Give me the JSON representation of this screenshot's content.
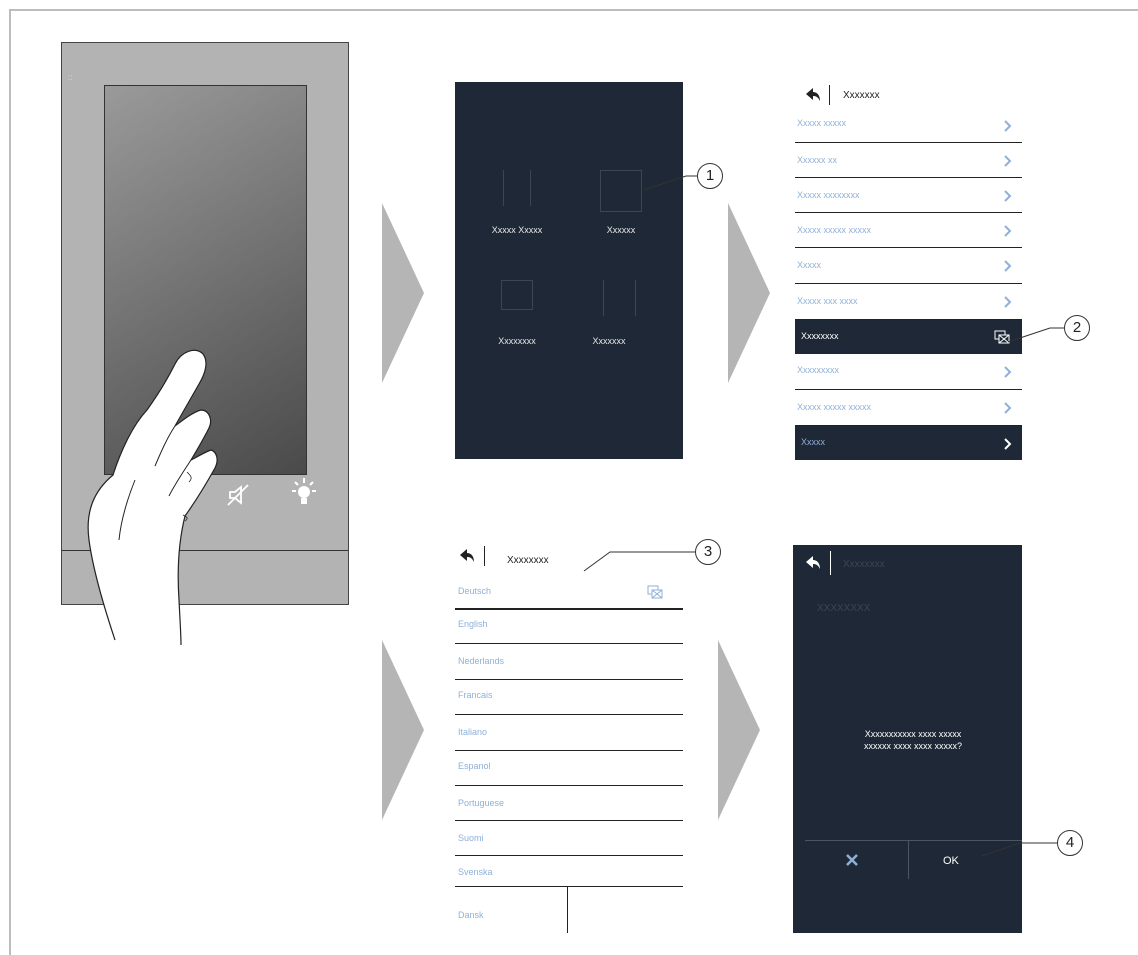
{
  "device": {
    "icons": [
      "mute-icon",
      "light-bulb-icon"
    ]
  },
  "panel1": {
    "items": [
      {
        "label": "Xxxxx Xxxxx"
      },
      {
        "label": "Xxxxxx"
      },
      {
        "label": "Xxxxxxxx"
      },
      {
        "label": "Xxxxxxx"
      }
    ]
  },
  "panel2": {
    "title": "Xxxxxxx",
    "rows": [
      {
        "label": "Xxxxx xxxxx"
      },
      {
        "label": "Xxxxxx xx"
      },
      {
        "label": "Xxxxx xxxxxxxx"
      },
      {
        "label": "Xxxxx xxxxx xxxxx"
      },
      {
        "label": "Xxxxx"
      },
      {
        "label": "Xxxxx xxx xxxx"
      },
      {
        "label": "Xxxxxxxx"
      },
      {
        "label": "Xxxxxxxxx"
      },
      {
        "label": "Xxxxx xxxxx xxxxx"
      },
      {
        "label": "Xxxxx"
      }
    ]
  },
  "panel3": {
    "title": "Xxxxxxxx",
    "languages": [
      "Deutsch",
      "English",
      "Nederlands",
      "Francais",
      "Italiano",
      "Espanol",
      "Portuguese",
      "Suomi",
      "Svenska",
      "Dansk"
    ]
  },
  "panel4": {
    "title": "Xxxxxxxx",
    "subtitle": "XXXXXXXX",
    "message_line1": "Xxxxxxxxxxx xxxx xxxxx",
    "message_line2": "xxxxxx xxxx xxxx xxxxx?",
    "ok_label": "OK"
  },
  "callouts": [
    "1",
    "2",
    "3",
    "4"
  ],
  "colors": {
    "screen_dark": "#1f2836",
    "link_blue": "#8fb0d8",
    "device_grey": "#b3b3b3",
    "arrow_grey": "#b5b5b5"
  }
}
